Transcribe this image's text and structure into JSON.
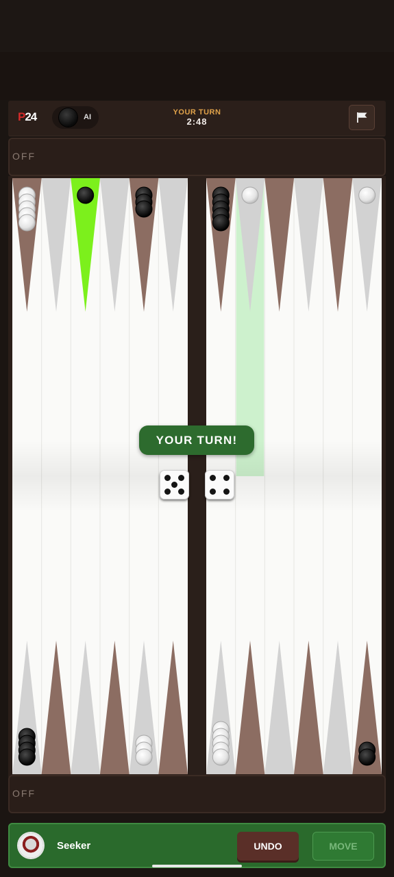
{
  "header": {
    "logo_p": "P",
    "logo_num": "24",
    "opponent_name": "AI",
    "turn_label": "YOUR TURN",
    "timer": "2:48",
    "resign_icon": "flag-icon"
  },
  "trays": {
    "top_label": "OFF",
    "bottom_label": "OFF"
  },
  "board": {
    "banner": "YOUR TURN!",
    "dice": [
      5,
      4
    ],
    "colors": {
      "frame": "#2a1e19",
      "field": "#fafaf8",
      "point_dark": "#8c6d62",
      "point_light": "#d2d2d2",
      "highlight": "#7cf01c",
      "move_hint": "#c8efc8",
      "white_checker": "#f0f0f0",
      "black_checker": "#1a1a1a"
    },
    "top_points": [
      {
        "color": "dark",
        "white": 5,
        "black": 0
      },
      {
        "color": "light",
        "white": 0,
        "black": 0
      },
      {
        "color": "highlight",
        "white": 0,
        "black": 1
      },
      {
        "color": "light",
        "white": 0,
        "black": 0
      },
      {
        "color": "dark",
        "white": 0,
        "black": 3
      },
      {
        "color": "light",
        "white": 0,
        "black": 0
      },
      {
        "color": "dark",
        "white": 0,
        "black": 5
      },
      {
        "color": "light",
        "white": 1,
        "black": 0
      },
      {
        "color": "dark",
        "white": 0,
        "black": 0
      },
      {
        "color": "light",
        "white": 0,
        "black": 0
      },
      {
        "color": "dark",
        "white": 0,
        "black": 0
      },
      {
        "color": "light",
        "white": 1,
        "black": 0
      }
    ],
    "bottom_points": [
      {
        "color": "light",
        "white": 0,
        "black": 4
      },
      {
        "color": "dark",
        "white": 0,
        "black": 0
      },
      {
        "color": "light",
        "white": 0,
        "black": 0
      },
      {
        "color": "dark",
        "white": 0,
        "black": 0
      },
      {
        "color": "light",
        "white": 3,
        "black": 0
      },
      {
        "color": "dark",
        "white": 0,
        "black": 0
      },
      {
        "color": "light",
        "white": 5,
        "black": 0
      },
      {
        "color": "dark",
        "white": 0,
        "black": 0
      },
      {
        "color": "light",
        "white": 0,
        "black": 0
      },
      {
        "color": "dark",
        "white": 0,
        "black": 0
      },
      {
        "color": "light",
        "white": 0,
        "black": 0
      },
      {
        "color": "dark",
        "white": 0,
        "black": 2
      }
    ],
    "hint_top_point": 7
  },
  "footer": {
    "player_name": "Seeker",
    "undo_label": "UNDO",
    "move_label": "MOVE"
  }
}
